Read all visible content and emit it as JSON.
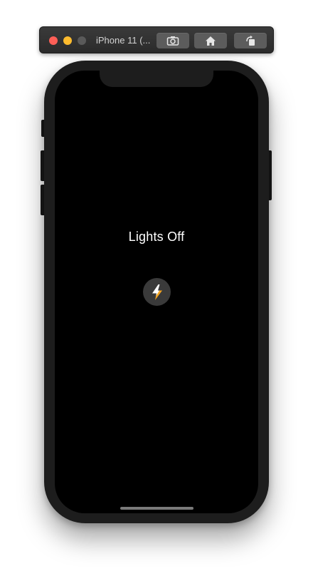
{
  "simulator": {
    "title": "iPhone 11 (...",
    "buttons": [
      "screenshot",
      "home",
      "rotate"
    ]
  },
  "app": {
    "status_label": "Lights Off",
    "toggle_icon": "lightning-bolt-icon",
    "background_color": "#000000",
    "button_color": "#3a3a3a",
    "icon_colors": [
      "#ffffff",
      "#f5a623"
    ]
  }
}
